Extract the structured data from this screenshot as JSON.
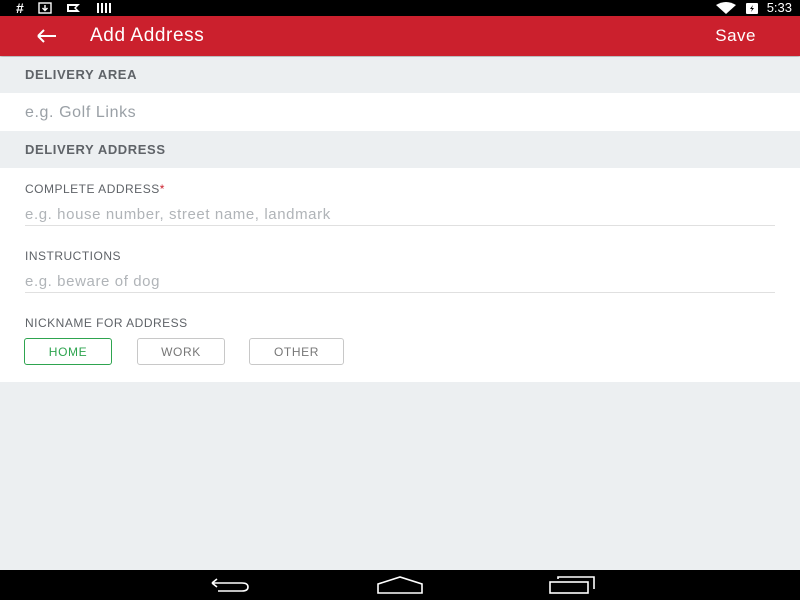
{
  "status_bar": {
    "left_icons": [
      "hash-icon",
      "download-icon",
      "flag-icon",
      "barcode-icon"
    ],
    "hash_text": "#",
    "right_icons": [
      "wifi-icon",
      "battery-icon"
    ],
    "time": "5:33"
  },
  "app_bar": {
    "title": "Add Address",
    "save_label": "Save",
    "color": "#cb202d"
  },
  "delivery_area": {
    "header": "DELIVERY AREA",
    "placeholder": "e.g. Golf Links",
    "value": ""
  },
  "delivery_address": {
    "header": "DELIVERY ADDRESS",
    "complete_address": {
      "label": "COMPLETE ADDRESS",
      "required_mark": "*",
      "placeholder": "e.g. house number, street name, landmark",
      "value": ""
    },
    "instructions": {
      "label": "INSTRUCTIONS",
      "placeholder": "e.g. beware of dog",
      "value": ""
    },
    "nickname": {
      "label": "NICKNAME FOR ADDRESS",
      "options": [
        "HOME",
        "WORK",
        "OTHER"
      ],
      "selected": "HOME",
      "selected_color": "#2ea44f"
    }
  },
  "nav_bar": {
    "buttons": [
      "back-icon",
      "home-icon",
      "recents-icon"
    ]
  }
}
